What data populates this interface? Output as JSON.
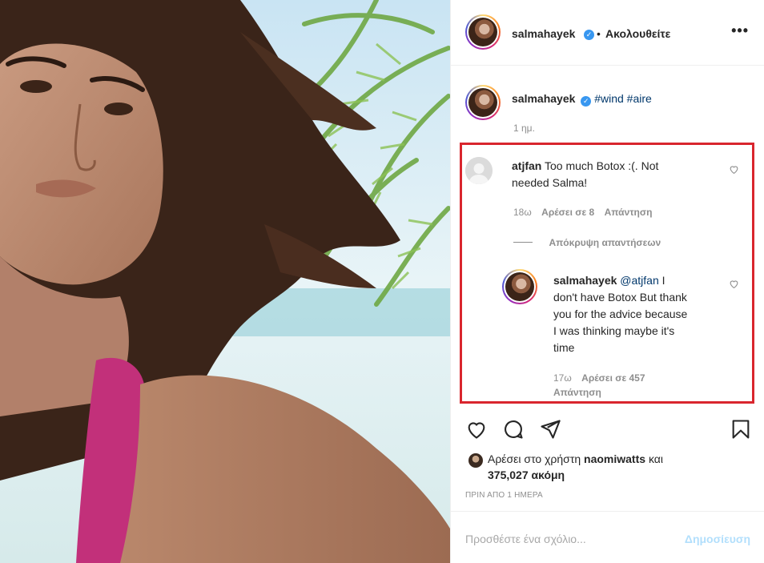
{
  "post": {
    "author": "salmahayek",
    "separator": "•",
    "follow_status": "Ακολουθείτε",
    "more_icon": "more-horizontal-icon",
    "caption": {
      "username": "salmahayek",
      "hashtags": [
        "#wind",
        "#aire"
      ],
      "age": "1 ημ."
    }
  },
  "comments": [
    {
      "username": "atjfan",
      "text_line1": "Too much Botox :(. Not",
      "text_line2": "needed Salma!",
      "age": "18ω",
      "likes": "Αρέσει σε 8",
      "reply": "Απάντηση",
      "hide_replies": "Απόκρυψη απαντήσεων",
      "replies": [
        {
          "username": "salmahayek",
          "mention": "@atjfan",
          "text_line1": "I",
          "text_line2": "don't have Botox But thank",
          "text_line3": "you for the advice because",
          "text_line4": "I was thinking maybe it's",
          "text_line5": "time",
          "age": "17ω",
          "likes": "Αρέσει σε 457",
          "reply": "Απάντηση"
        }
      ]
    }
  ],
  "actions": {
    "like_icon": "heart-icon",
    "comment_icon": "comment-icon",
    "share_icon": "share-icon",
    "save_icon": "bookmark-icon"
  },
  "likes": {
    "prefix": "Αρέσει στο χρήστη",
    "user": "naomiwatts",
    "conjunction": "και",
    "count": "375,027 ακόμη"
  },
  "timestamp": "ΠΡΙΝ ΑΠΟ 1 ΗΜΕΡΑ",
  "add_comment": {
    "placeholder": "Προσθέστε ένα σχόλιο...",
    "post_label": "Δημοσίευση"
  },
  "colors": {
    "highlight_border": "#d9262e",
    "link": "#00376b",
    "verified": "#3897f0",
    "post_button_disabled": "#b2dffc"
  }
}
